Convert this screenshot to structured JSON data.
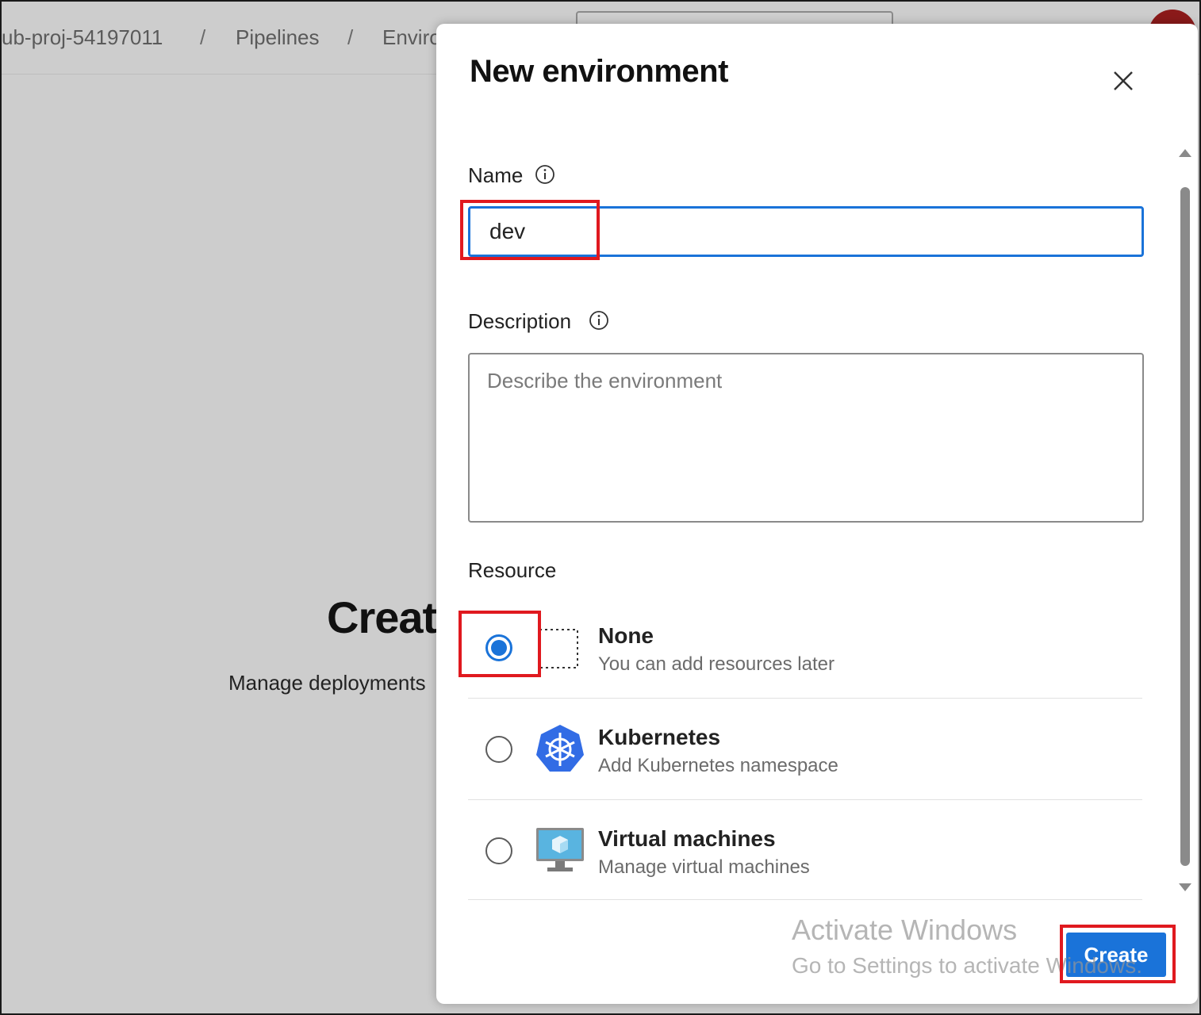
{
  "breadcrumb": {
    "items": [
      "ub-proj-54197011",
      "Pipelines",
      "Enviro"
    ],
    "separator": "/"
  },
  "background": {
    "heading": "Create",
    "subtext": "Manage deployments"
  },
  "dialog": {
    "title": "New environment",
    "close_icon": "close-icon",
    "name": {
      "label": "Name",
      "value": "dev",
      "info_icon": "info-icon"
    },
    "description": {
      "label": "Description",
      "placeholder": "Describe the environment",
      "value": "",
      "info_icon": "info-icon"
    },
    "resource": {
      "label": "Resource",
      "options": [
        {
          "title": "None",
          "desc": "You can add resources later",
          "icon": "dotted-square-icon",
          "selected": true
        },
        {
          "title": "Kubernetes",
          "desc": "Add Kubernetes namespace",
          "icon": "kubernetes-icon",
          "selected": false
        },
        {
          "title": "Virtual machines",
          "desc": "Manage virtual machines",
          "icon": "virtual-machine-icon",
          "selected": false
        }
      ]
    },
    "create_label": "Create"
  },
  "watermark": {
    "line1": "Activate Windows",
    "line2": "Go to Settings to activate Windows."
  },
  "colors": {
    "accent": "#1a73d9",
    "annotation": "#e0191f",
    "overlay": "#cdcdcd"
  }
}
